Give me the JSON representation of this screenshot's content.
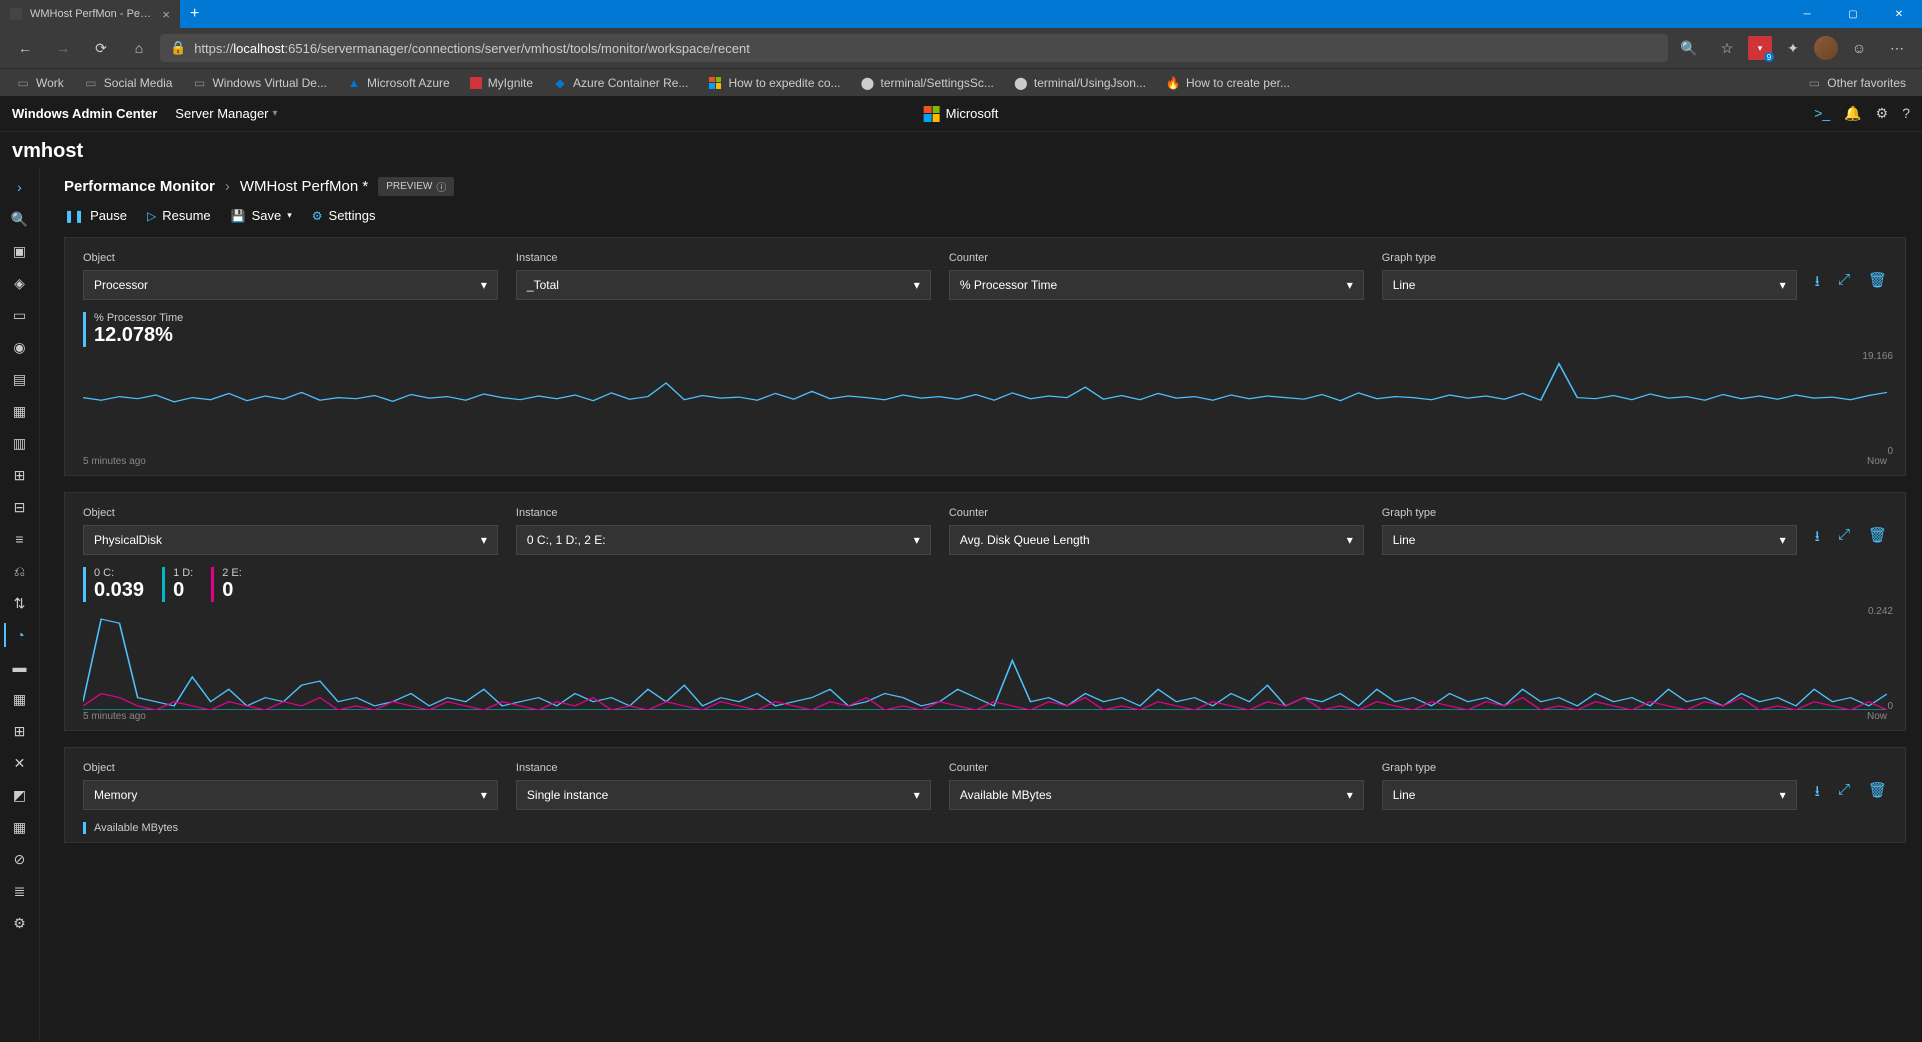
{
  "browser": {
    "tab_title": "WMHost PerfMon - Performance",
    "url_pre": "https://",
    "url_host": "localhost",
    "url_rest": ":6516/servermanager/connections/server/vmhost/tools/monitor/workspace/recent",
    "bookmarks": [
      "Work",
      "Social Media",
      "Windows Virtual De...",
      "Microsoft Azure",
      "MyIgnite",
      "Azure Container Re...",
      "How to expedite co...",
      "terminal/SettingsSc...",
      "terminal/UsingJson...",
      "How to create per..."
    ],
    "other_fav": "Other favorites"
  },
  "wac": {
    "brand": "Windows Admin Center",
    "nav": "Server Manager",
    "ms": "Microsoft"
  },
  "host": "vmhost",
  "crumb": {
    "root": "Performance Monitor",
    "current": "WMHost PerfMon *",
    "badge": "PREVIEW"
  },
  "actions": {
    "pause": "Pause",
    "resume": "Resume",
    "save": "Save",
    "settings": "Settings"
  },
  "labels": {
    "object": "Object",
    "instance": "Instance",
    "counter": "Counter",
    "graph": "Graph type"
  },
  "panels": [
    {
      "object": "Processor",
      "instance": "_Total",
      "counter": "% Processor Time",
      "graph": "Line",
      "metrics": [
        {
          "label": "% Processor Time",
          "value": "12.078%",
          "bar": "blue"
        }
      ],
      "ymax": "19.166",
      "ymin": "0",
      "tmin": "5 minutes ago",
      "tmax": "Now"
    },
    {
      "object": "PhysicalDisk",
      "instance": "0 C:, 1 D:, 2 E:",
      "counter": "Avg. Disk Queue Length",
      "graph": "Line",
      "metrics": [
        {
          "label": "0 C:",
          "value": "0.039",
          "bar": "blue"
        },
        {
          "label": "1 D:",
          "value": "0",
          "bar": "teal"
        },
        {
          "label": "2 E:",
          "value": "0",
          "bar": "pink"
        }
      ],
      "ymax": "0.242",
      "ymin": "0",
      "tmin": "5 minutes ago",
      "tmax": "Now"
    },
    {
      "object": "Memory",
      "instance": "Single instance",
      "counter": "Available MBytes",
      "graph": "Line",
      "metrics": [
        {
          "label": "Available MBytes",
          "value": "",
          "bar": "blue"
        }
      ]
    }
  ],
  "chart_data": [
    {
      "type": "line",
      "title": "% Processor Time",
      "ylim": [
        0,
        19.166
      ],
      "xrange": [
        "5 minutes ago",
        "Now"
      ],
      "series": [
        {
          "name": "_Total",
          "color": "#4cc2ff",
          "values": [
            11,
            10.5,
            11.2,
            10.8,
            11.5,
            10.2,
            11,
            10.6,
            11.8,
            10.4,
            11.3,
            10.7,
            12,
            10.5,
            11,
            10.8,
            11.4,
            10.3,
            11.6,
            10.9,
            11.2,
            10.5,
            11.7,
            11,
            10.6,
            11.3,
            10.8,
            11.5,
            10.4,
            11.9,
            10.7,
            11.2,
            13.8,
            10.6,
            11.4,
            10.9,
            11.1,
            10.5,
            11.8,
            10.7,
            12.2,
            10.8,
            11.3,
            11,
            10.6,
            11.5,
            10.9,
            11.2,
            10.7,
            11.6,
            10.5,
            11.9,
            10.8,
            11.3,
            11,
            13,
            10.7,
            11.4,
            10.6,
            11.8,
            10.9,
            11.2,
            10.5,
            11.5,
            10.8,
            11.3,
            11,
            10.7,
            11.6,
            10.4,
            11.9,
            10.8,
            11.2,
            11,
            10.6,
            11.5,
            10.9,
            11.3,
            10.7,
            11.8,
            10.5,
            17.5,
            11,
            10.8,
            11.4,
            10.6,
            11.7,
            10.9,
            11.2,
            10.5,
            11.6,
            10.8,
            11.3,
            10.7,
            11.5,
            10.9,
            11.1,
            10.6,
            11.4,
            12
          ]
        }
      ]
    },
    {
      "type": "line",
      "title": "Avg. Disk Queue Length",
      "ylim": [
        0,
        0.242
      ],
      "xrange": [
        "5 minutes ago",
        "Now"
      ],
      "series": [
        {
          "name": "0 C:",
          "color": "#4cc2ff",
          "values": [
            0.02,
            0.22,
            0.21,
            0.03,
            0.02,
            0.01,
            0.08,
            0.02,
            0.05,
            0.01,
            0.03,
            0.02,
            0.06,
            0.07,
            0.02,
            0.03,
            0.01,
            0.02,
            0.04,
            0.01,
            0.03,
            0.02,
            0.05,
            0.01,
            0.02,
            0.03,
            0.01,
            0.04,
            0.02,
            0.03,
            0.01,
            0.05,
            0.02,
            0.06,
            0.01,
            0.03,
            0.02,
            0.04,
            0.01,
            0.02,
            0.03,
            0.05,
            0.01,
            0.02,
            0.04,
            0.03,
            0.01,
            0.02,
            0.05,
            0.03,
            0.01,
            0.12,
            0.02,
            0.03,
            0.01,
            0.04,
            0.02,
            0.03,
            0.01,
            0.05,
            0.02,
            0.03,
            0.01,
            0.04,
            0.02,
            0.06,
            0.01,
            0.03,
            0.02,
            0.04,
            0.01,
            0.05,
            0.02,
            0.03,
            0.01,
            0.04,
            0.02,
            0.03,
            0.01,
            0.05,
            0.02,
            0.03,
            0.01,
            0.04,
            0.02,
            0.03,
            0.01,
            0.05,
            0.02,
            0.03,
            0.01,
            0.04,
            0.02,
            0.03,
            0.01,
            0.05,
            0.02,
            0.03,
            0.01,
            0.039
          ]
        },
        {
          "name": "1 D:",
          "color": "#00b7c3",
          "values": [
            0,
            0,
            0,
            0,
            0,
            0,
            0,
            0,
            0,
            0,
            0,
            0,
            0,
            0,
            0,
            0,
            0,
            0,
            0,
            0,
            0,
            0,
            0,
            0,
            0,
            0,
            0,
            0,
            0,
            0,
            0,
            0,
            0,
            0,
            0,
            0,
            0,
            0,
            0,
            0,
            0,
            0,
            0,
            0,
            0,
            0,
            0,
            0,
            0,
            0,
            0,
            0,
            0,
            0,
            0,
            0,
            0,
            0,
            0,
            0,
            0,
            0,
            0,
            0,
            0,
            0,
            0,
            0,
            0,
            0,
            0,
            0,
            0,
            0,
            0,
            0,
            0,
            0,
            0,
            0,
            0,
            0,
            0,
            0,
            0,
            0,
            0,
            0,
            0,
            0,
            0,
            0,
            0,
            0,
            0,
            0,
            0,
            0,
            0,
            0
          ]
        },
        {
          "name": "2 E:",
          "color": "#e3008c",
          "values": [
            0.01,
            0.04,
            0.03,
            0.01,
            0,
            0.02,
            0.01,
            0,
            0.02,
            0.01,
            0,
            0.02,
            0.01,
            0.03,
            0,
            0.01,
            0,
            0.02,
            0.01,
            0,
            0.02,
            0.01,
            0,
            0.02,
            0.01,
            0,
            0.02,
            0.01,
            0.03,
            0,
            0.01,
            0,
            0.02,
            0.01,
            0,
            0.02,
            0.01,
            0,
            0.02,
            0.01,
            0,
            0.02,
            0.01,
            0.03,
            0,
            0.01,
            0,
            0.02,
            0.01,
            0,
            0.02,
            0.01,
            0,
            0.02,
            0.01,
            0.03,
            0,
            0.01,
            0,
            0.02,
            0.01,
            0,
            0.02,
            0.01,
            0,
            0.02,
            0.01,
            0.03,
            0,
            0.01,
            0,
            0.02,
            0.01,
            0,
            0.02,
            0.01,
            0,
            0.02,
            0.01,
            0.03,
            0,
            0.01,
            0,
            0.02,
            0.01,
            0,
            0.02,
            0.01,
            0,
            0.02,
            0.01,
            0.03,
            0,
            0.01,
            0,
            0.02,
            0.01,
            0,
            0.02,
            0
          ]
        }
      ]
    }
  ]
}
